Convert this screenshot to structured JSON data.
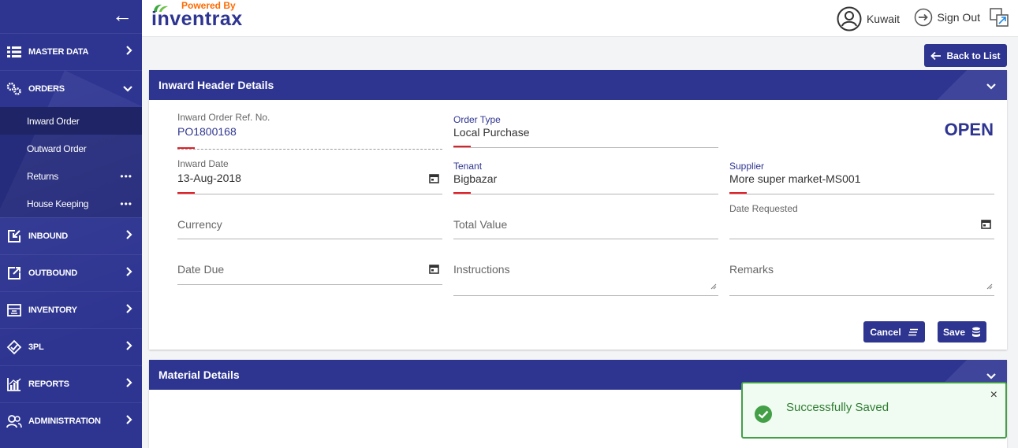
{
  "brand": {
    "powered": "Powered By",
    "name": "inventrax"
  },
  "header": {
    "user": "Kuwait",
    "signout": "Sign Out"
  },
  "sidebar": {
    "items": [
      {
        "label": "MASTER DATA"
      },
      {
        "label": "ORDERS"
      },
      {
        "label": "INBOUND"
      },
      {
        "label": "OUTBOUND"
      },
      {
        "label": "INVENTORY"
      },
      {
        "label": "3PL"
      },
      {
        "label": "REPORTS"
      },
      {
        "label": "ADMINISTRATION"
      }
    ],
    "orders_sub": [
      {
        "label": "Inward Order"
      },
      {
        "label": "Outward Order"
      },
      {
        "label": "Returns"
      },
      {
        "label": "House Keeping"
      }
    ]
  },
  "back_to_list": "Back to List",
  "inward_header": {
    "title": "Inward Header Details",
    "status": "OPEN",
    "ref_label": "Inward Order Ref. No.",
    "ref_value": "PO1800168",
    "order_type_label": "Order Type",
    "order_type_value": "Local Purchase",
    "inward_date_label": "Inward Date",
    "inward_date_value": "13-Aug-2018",
    "tenant_label": "Tenant",
    "tenant_value": "Bigbazar",
    "supplier_label": "Supplier",
    "supplier_value": "More super market-MS001",
    "currency_placeholder": "Currency",
    "total_value_placeholder": "Total Value",
    "date_requested_label": "Date Requested",
    "date_due_placeholder": "Date Due",
    "instructions_placeholder": "Instructions",
    "remarks_placeholder": "Remarks",
    "cancel": "Cancel",
    "save": "Save"
  },
  "material": {
    "title": "Material Details"
  },
  "toast": {
    "message": "Successfully Saved",
    "close": "×"
  },
  "colors": {
    "primary": "#2e3591",
    "accent_red": "#e21f26",
    "success": "#43a047"
  }
}
